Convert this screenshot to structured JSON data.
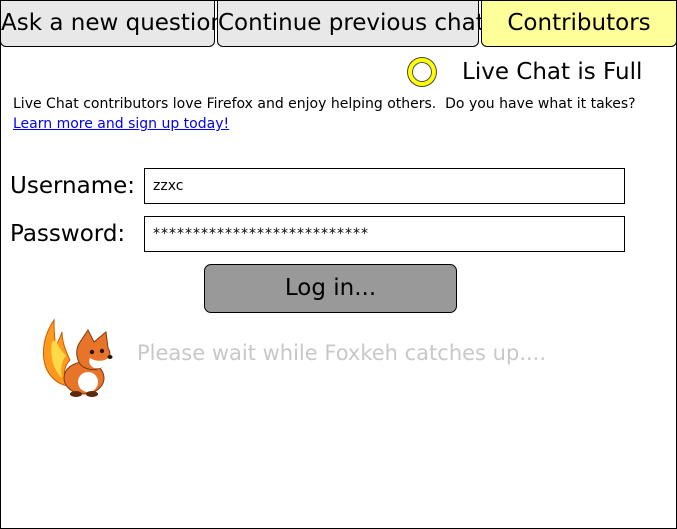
{
  "tabs": [
    {
      "label": "Ask a new question",
      "active": false
    },
    {
      "label": "Continue previous chat",
      "active": false
    },
    {
      "label": "Contributors",
      "active": true
    }
  ],
  "status": {
    "text": "Live Chat is Full",
    "indicator_color": "#ffff00"
  },
  "intro": {
    "text": "Live Chat contributors love Firefox and enjoy helping others.  Do you have what it takes?",
    "link_text": "Learn more and sign up today!"
  },
  "form": {
    "username_label": "Username:",
    "username_value": "zzxc",
    "password_label": "Password:",
    "password_value": "***************************",
    "login_label": "Log in..."
  },
  "loading": {
    "mascot_icon": "foxkeh-fox-icon",
    "text": "Please wait while Foxkeh catches up...."
  },
  "colors": {
    "active_tab": "#ffff99",
    "inactive_tab": "#e8e8e8",
    "login_button": "#999999",
    "link": "#0000ee",
    "wait_text": "#c8c8c8"
  }
}
